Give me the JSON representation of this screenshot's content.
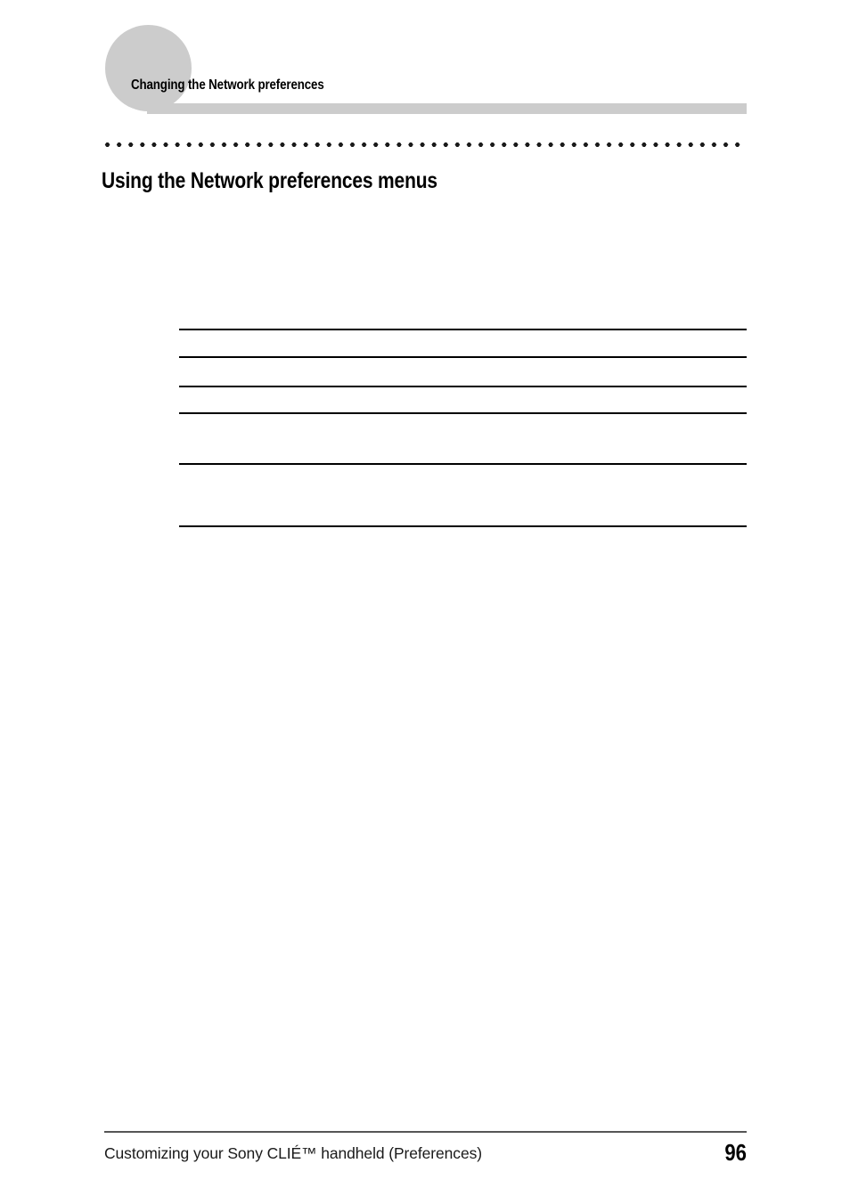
{
  "document": {
    "running_header": "Changing the Network preferences",
    "section_heading": "Using the Network preferences menus"
  },
  "table": {
    "rule_positions_y": [
      369,
      400,
      433,
      463,
      520,
      590
    ],
    "rows": [
      {
        "cells": [
          "",
          ""
        ]
      },
      {
        "cells": [
          "",
          ""
        ]
      },
      {
        "cells": [
          "",
          ""
        ]
      },
      {
        "cells": [
          "",
          ""
        ]
      },
      {
        "cells": [
          "",
          ""
        ]
      }
    ]
  },
  "footer": {
    "text": "Customizing your Sony CLIÉ™ handheld (Preferences)",
    "page_number": "96"
  },
  "colors": {
    "decor_gray": "#cccccc",
    "footer_rule": "#555555",
    "text": "#000000",
    "background": "#ffffff"
  }
}
